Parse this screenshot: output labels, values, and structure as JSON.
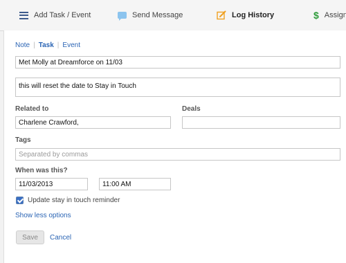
{
  "tabs": {
    "add_task_event": "Add Task / Event",
    "send_message": "Send Message",
    "log_history": "Log History",
    "assign": "Assign"
  },
  "type_switch": {
    "note": "Note",
    "task": "Task",
    "event": "Event",
    "selected": "Task"
  },
  "form": {
    "subject_value": "Met Molly at Dreamforce on 11/03",
    "description_value": "this will reset the date to Stay in Touch",
    "related_to_label": "Related to",
    "related_to_value": "Charlene Crawford,",
    "deals_label": "Deals",
    "deals_value": "",
    "tags_label": "Tags",
    "tags_placeholder": "Separated by commas",
    "when_label": "When was this?",
    "date_value": "11/03/2013",
    "time_value": "11:00 AM",
    "update_reminder_label": "Update stay in touch reminder",
    "update_reminder_checked": true,
    "show_less_label": "Show less options",
    "save_label": "Save",
    "cancel_label": "Cancel"
  },
  "icons": {
    "add_task": "list-icon",
    "send_message": "chat-bubble-icon",
    "log_history": "edit-note-icon",
    "assign": "dollar-icon"
  },
  "colors": {
    "link": "#2a64b4",
    "active_icon": "#f0a020",
    "assign_icon": "#2e9c3a"
  }
}
